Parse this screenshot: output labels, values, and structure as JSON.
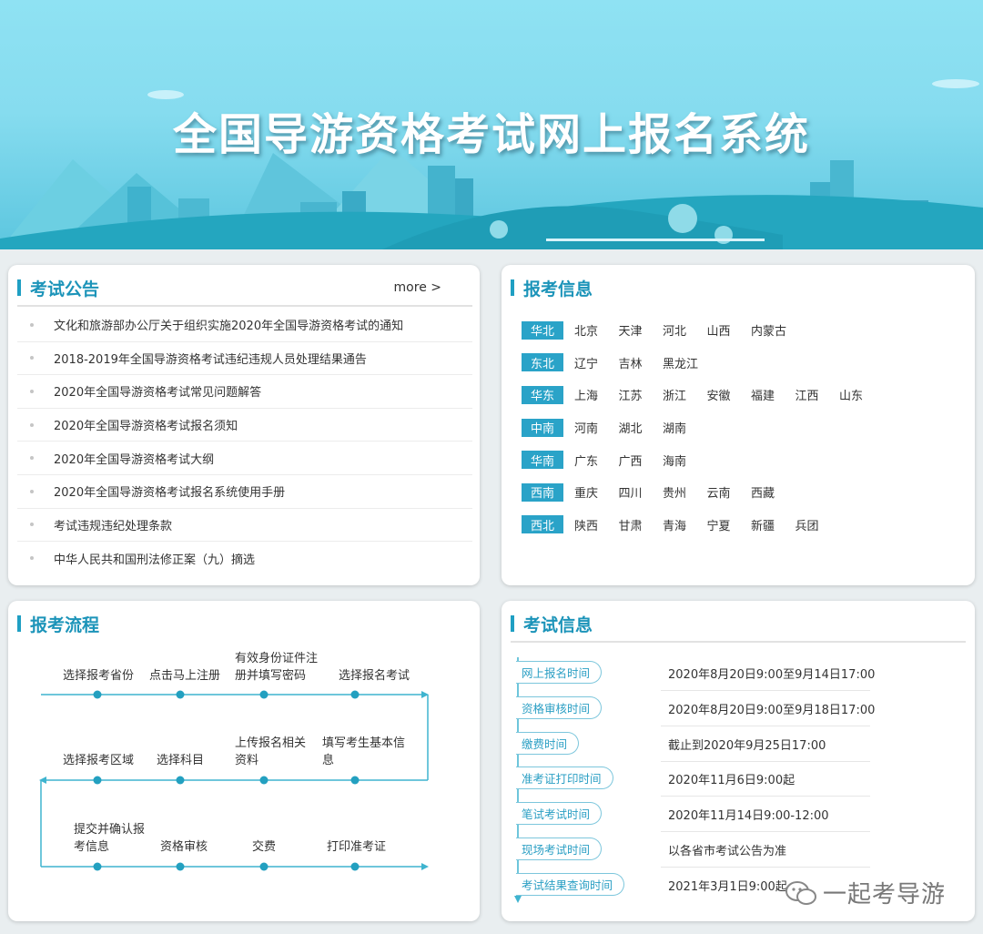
{
  "banner": {
    "title": "全国导游资格考试网上报名系统"
  },
  "announcements": {
    "title": "考试公告",
    "more": "more >",
    "items": [
      "文化和旅游部办公厅关于组织实施2020年全国导游资格考试的通知",
      "2018-2019年全国导游资格考试违纪违规人员处理结果通告",
      "2020年全国导游资格考试常见问题解答",
      "2020年全国导游资格考试报名须知",
      "2020年全国导游资格考试大纲",
      "2020年全国导游资格考试报名系统使用手册",
      "考试违规违纪处理条款",
      "中华人民共和国刑法修正案（九）摘选"
    ]
  },
  "registration_info": {
    "title": "报考信息",
    "regions": [
      {
        "name": "华北",
        "provinces": [
          "北京",
          "天津",
          "河北",
          "山西",
          "内蒙古"
        ]
      },
      {
        "name": "东北",
        "provinces": [
          "辽宁",
          "吉林",
          "黑龙江"
        ]
      },
      {
        "name": "华东",
        "provinces": [
          "上海",
          "江苏",
          "浙江",
          "安徽",
          "福建",
          "江西",
          "山东"
        ]
      },
      {
        "name": "中南",
        "provinces": [
          "河南",
          "湖北",
          "湖南"
        ]
      },
      {
        "name": "华南",
        "provinces": [
          "广东",
          "广西",
          "海南"
        ]
      },
      {
        "name": "西南",
        "provinces": [
          "重庆",
          "四川",
          "贵州",
          "云南",
          "西藏"
        ]
      },
      {
        "name": "西北",
        "provinces": [
          "陕西",
          "甘肃",
          "青海",
          "宁夏",
          "新疆",
          "兵团"
        ]
      }
    ]
  },
  "process": {
    "title": "报考流程",
    "steps": [
      {
        "line1": "选择报考省份",
        "line2": ""
      },
      {
        "line1": "点击马上注册",
        "line2": ""
      },
      {
        "line1": "有效身份证件注",
        "line2": "册并填写密码"
      },
      {
        "line1": "选择报名考试",
        "line2": ""
      },
      {
        "line1": "选择报考区域",
        "line2": ""
      },
      {
        "line1": "选择科目",
        "line2": ""
      },
      {
        "line1": "上传报名相关",
        "line2": "资料"
      },
      {
        "line1": "填写考生基本信",
        "line2": "息"
      },
      {
        "line1": "提交并确认报",
        "line2": "考信息"
      },
      {
        "line1": "资格审核",
        "line2": ""
      },
      {
        "line1": "交费",
        "line2": ""
      },
      {
        "line1": "打印准考证",
        "line2": ""
      }
    ]
  },
  "exam_info": {
    "title": "考试信息",
    "rows": [
      {
        "label": "网上报名时间",
        "value": "2020年8月20日9:00至9月14日17:00"
      },
      {
        "label": "资格审核时间",
        "value": "2020年8月20日9:00至9月18日17:00"
      },
      {
        "label": "缴费时间",
        "value": "截止到2020年9月25日17:00"
      },
      {
        "label": "准考证打印时间",
        "value": "2020年11月6日9:00起"
      },
      {
        "label": "笔试考试时间",
        "value": "2020年11月14日9:00-12:00"
      },
      {
        "label": "现场考试时间",
        "value": "以各省市考试公告为准"
      },
      {
        "label": "考试结果查询时间",
        "value": "2021年3月1日9:00起"
      }
    ]
  },
  "watermark": {
    "text": "一起考导游"
  },
  "colors": {
    "accent": "#1f9fc3",
    "tag_bg": "#2aa3c8"
  }
}
